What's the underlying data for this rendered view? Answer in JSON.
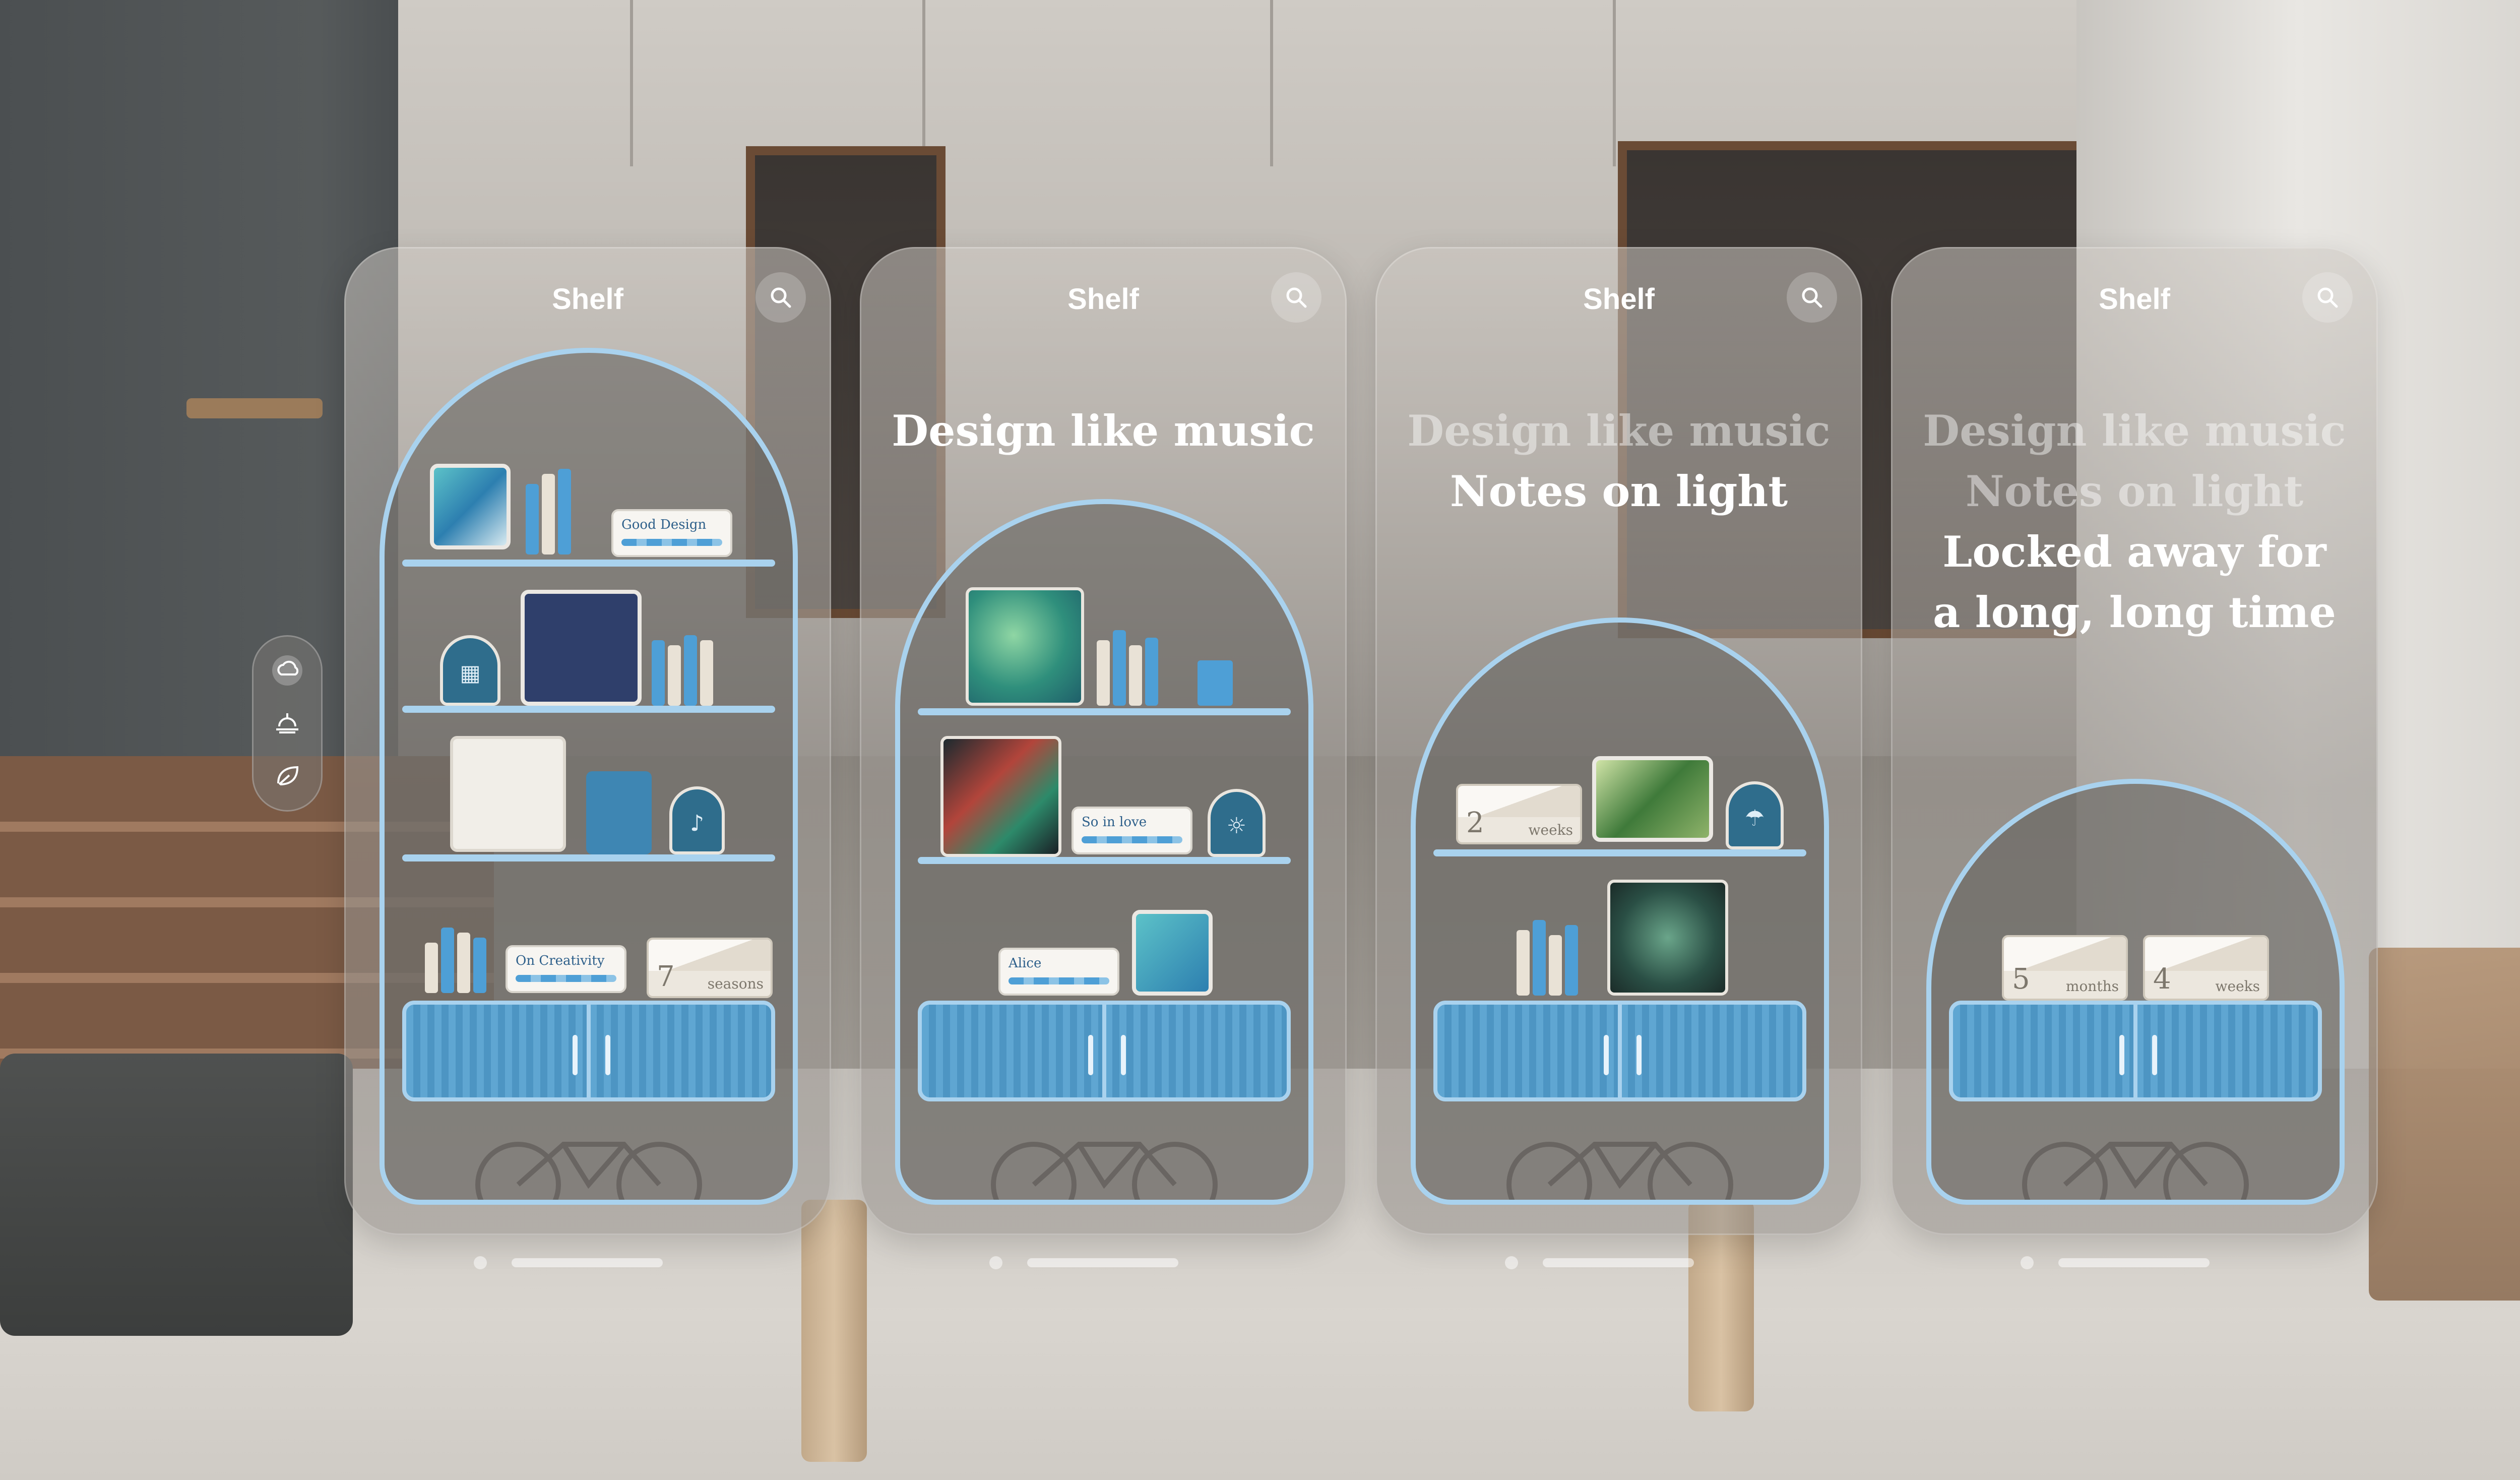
{
  "app": {
    "title": "Shelf"
  },
  "windows": [
    {
      "title": "Shelf",
      "lines": []
    },
    {
      "title": "Shelf",
      "lines": [
        "Design like music"
      ]
    },
    {
      "title": "Shelf",
      "lines": [
        "Design like music",
        "Notes on light"
      ]
    },
    {
      "title": "Shelf",
      "lines": [
        "Design like music",
        "Notes on light",
        "Locked away for",
        "a long, long time"
      ]
    }
  ],
  "shelf_items": {
    "good_design_card": "Good Design",
    "on_creativity_card": "On Creativity",
    "so_in_love_card": "So in love",
    "alice_card": "Alice",
    "envelope_seasons": {
      "number": "7",
      "unit": "seasons"
    },
    "envelope_weeks_a": {
      "number": "2",
      "unit": "weeks"
    },
    "envelope_months": {
      "number": "5",
      "unit": "months"
    },
    "envelope_weeks_b": {
      "number": "4",
      "unit": "weeks"
    }
  },
  "ornament": {
    "buttons": [
      "cloud-sun-icon",
      "sunrise-icon",
      "leaf-icon"
    ],
    "active_index": 0
  },
  "colors": {
    "accent": "#a9d2ee",
    "cabinet": "#5fa6d2",
    "badge": "#2f6d8c"
  },
  "icons": [
    "search-icon",
    "bicycle-icon",
    "music-note-icon",
    "building-icon",
    "sun-icon",
    "cloud-rain-icon",
    "audio-wave-icon"
  ]
}
